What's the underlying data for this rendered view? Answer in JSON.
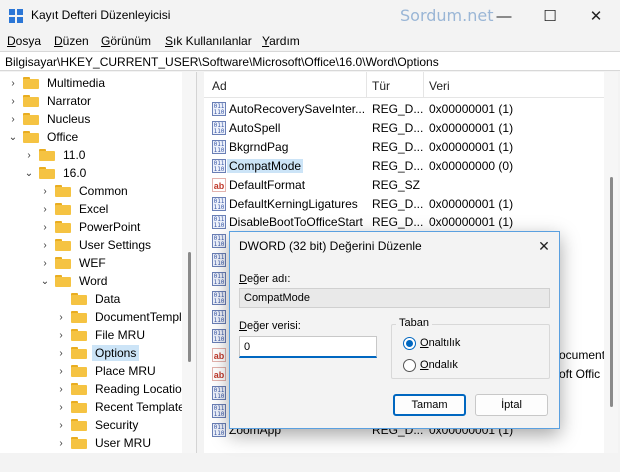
{
  "window": {
    "title": "Kayıt Defteri Düzenleyicisi",
    "watermark": "Sordum.net",
    "minimize_glyph": "—",
    "maximize_glyph": "☐",
    "close_glyph": "✕"
  },
  "menu": [
    {
      "label_u": "D",
      "label_rest": "osya"
    },
    {
      "label_u": "D",
      "label_rest": "üzen"
    },
    {
      "label_u": "G",
      "label_rest": "örünüm"
    },
    {
      "label_u": "S",
      "label_rest": "ık Kullanılanlar"
    },
    {
      "label_u": "Y",
      "label_rest": "ardım"
    }
  ],
  "path": "Bilgisayar\\HKEY_CURRENT_USER\\Software\\Microsoft\\Office\\16.0\\Word\\Options",
  "tree": [
    {
      "label": "Multimedia",
      "chev": "›"
    },
    {
      "label": "Narrator",
      "chev": "›"
    },
    {
      "label": "Nucleus",
      "chev": "›"
    },
    {
      "label": "Office",
      "chev": "⌄"
    },
    {
      "label": "11.0",
      "chev": "›"
    },
    {
      "label": "16.0",
      "chev": "⌄"
    },
    {
      "label": "Common",
      "chev": "›"
    },
    {
      "label": "Excel",
      "chev": "›"
    },
    {
      "label": "PowerPoint",
      "chev": "›"
    },
    {
      "label": "User Settings",
      "chev": "›"
    },
    {
      "label": "WEF",
      "chev": "›"
    },
    {
      "label": "Word",
      "chev": "⌄"
    },
    {
      "label": "Data",
      "chev": ""
    },
    {
      "label": "DocumentTempl",
      "chev": "›"
    },
    {
      "label": "File MRU",
      "chev": "›"
    },
    {
      "label": "Options",
      "chev": "›"
    },
    {
      "label": "Place MRU",
      "chev": "›"
    },
    {
      "label": "Reading Location",
      "chev": "›"
    },
    {
      "label": "Recent Template",
      "chev": "›"
    },
    {
      "label": "Security",
      "chev": "›"
    },
    {
      "label": "User MRU",
      "chev": "›"
    }
  ],
  "list": {
    "headers": [
      "Ad",
      "Tür",
      "Veri"
    ],
    "rows": [
      {
        "name": "AutoRecoverySaveInter...",
        "type": "REG_D...",
        "data": "0x00000001 (1)",
        "kind": "bin"
      },
      {
        "name": "AutoSpell",
        "type": "REG_D...",
        "data": "0x00000001 (1)",
        "kind": "bin"
      },
      {
        "name": "BkgrndPag",
        "type": "REG_D...",
        "data": "0x00000001 (1)",
        "kind": "bin"
      },
      {
        "name": "CompatMode",
        "type": "REG_D...",
        "data": "0x00000000 (0)",
        "kind": "bin"
      },
      {
        "name": "DefaultFormat",
        "type": "REG_SZ",
        "data": "",
        "kind": "str"
      },
      {
        "name": "DefaultKerningLigatures",
        "type": "REG_D...",
        "data": "0x00000001 (1)",
        "kind": "bin"
      },
      {
        "name": "DisableBootToOfficeStart",
        "type": "REG_D...",
        "data": "0x00000001 (1)",
        "kind": "bin"
      },
      {
        "name": "",
        "type": "",
        "data": "",
        "kind": "bin"
      },
      {
        "name": "",
        "type": "",
        "data": "",
        "kind": "bin"
      },
      {
        "name": "",
        "type": "",
        "data": "",
        "kind": "bin"
      },
      {
        "name": "",
        "type": "",
        "data": "",
        "kind": "bin"
      },
      {
        "name": "",
        "type": "",
        "data": "",
        "kind": "bin"
      },
      {
        "name": "",
        "type": "",
        "data": "",
        "kind": "bin"
      },
      {
        "name": "",
        "type": "",
        "data": "ocument",
        "kind": "str"
      },
      {
        "name": "",
        "type": "",
        "data": "oft Offic",
        "kind": "str"
      },
      {
        "name": "",
        "type": "",
        "data": "",
        "kind": "bin"
      },
      {
        "name": "",
        "type": "",
        "data": "",
        "kind": "bin"
      },
      {
        "name": "ZoomApp",
        "type": "REG_D...",
        "data": "0x00000001 (1)",
        "kind": "bin"
      }
    ],
    "icon_bin_text": "011\n110",
    "icon_str_text": "ab"
  },
  "dialog": {
    "title": "DWORD (32 bit) Değerini Düzenle",
    "close_glyph": "✕",
    "name_label_u": "D",
    "name_label_rest": "eğer adı:",
    "name_value": "CompatMode",
    "value_label_u": "D",
    "value_label_rest": "eğer verisi:",
    "value": "0",
    "base_title": "Taban",
    "hex_u": "O",
    "hex_rest": "naltılık",
    "dec_u": "O",
    "dec_rest": "ndalık",
    "ok": "Tamam",
    "cancel": "İptal"
  }
}
